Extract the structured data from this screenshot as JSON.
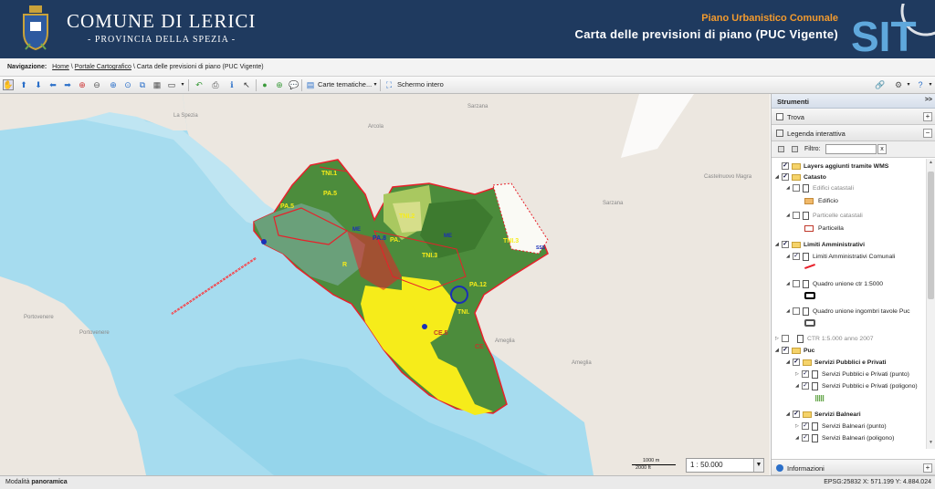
{
  "header": {
    "town": "COMUNE DI LERICI",
    "province": "- PROVINCIA DELLA SPEZIA -",
    "plan": "Piano Urbanistico Comunale",
    "map_title": "Carta delle previsioni di piano (PUC Vigente)",
    "logo_text": "SIT",
    "colors": {
      "background": "#1f3a5f",
      "accent": "#f29a2e"
    }
  },
  "breadcrumb": {
    "label": "Navigazione:",
    "home": "Home",
    "sep1": " \\ ",
    "portal": "Portale Cartografico",
    "sep2": " \\ ",
    "current": "Carta delle previsioni di piano (PUC Vigente)"
  },
  "toolbar": {
    "icons": [
      "pan-icon",
      "up-arrow-icon",
      "down-arrow-icon",
      "left-arrow-icon",
      "right-arrow-icon",
      "zoom-box-icon",
      "zoom-out-icon",
      "zoom-in-icon",
      "zoom-extent-icon",
      "zoom-layer-icon",
      "zoom-selection-icon",
      "measure-icon",
      "back-icon",
      "print-icon",
      "identify-icon",
      "select-icon",
      "globe-icon",
      "add-icon",
      "comment-icon",
      "layers-icon",
      "fullscreen-icon",
      "link-icon",
      "settings-icon",
      "help-icon"
    ],
    "thematic_maps": "Carte tematiche...",
    "fullscreen": "Schermo intero"
  },
  "map": {
    "places": [
      "La Spezia",
      "Sarzana",
      "Arcola",
      "Castelnuovo Magra",
      "Sarzana",
      "Portovenere",
      "Portovenere",
      "Ameglia",
      "Ameglia"
    ],
    "zones": [
      "TNI.1",
      "PA.5",
      "PA.5",
      "TNI.2",
      "ME",
      "PA.8",
      "TNI.3",
      "TNI.3",
      "PA.12",
      "SSS",
      "ME",
      "CE.5",
      "CE",
      "TNI.",
      "PA.",
      "R"
    ],
    "colors": {
      "sea": "#a6dcef",
      "land": "#ece7e0",
      "green": "#4c8c3c",
      "yellow": "#f6ec1a",
      "red": "#e8202a"
    }
  },
  "scale": {
    "bar_m": "1000 m",
    "bar_ft": "2000 ft",
    "value": "1 : 50.000"
  },
  "panel": {
    "title": "Strumenti",
    "collapse": ">>",
    "trova": "Trova",
    "legend": "Legenda interattiva",
    "filter_label": "Filtro:",
    "filter_clear": "x",
    "info": "Informazioni",
    "plus": "+",
    "minus": "−"
  },
  "tree": [
    {
      "label": "Layers aggiunti tramite WMS",
      "bold": true
    },
    {
      "label": "Catasto",
      "bold": true
    },
    {
      "label": "Edifici catastali",
      "gray": true
    },
    {
      "label": "Edificio"
    },
    {
      "label": "Particelle catastali",
      "gray": true
    },
    {
      "label": "Particella"
    },
    {
      "label": "Limiti Amministrativi",
      "bold": true
    },
    {
      "label": "Limiti Amministrativi Comunali"
    },
    {
      "label": "Quadro unione ctr 1:5000"
    },
    {
      "label": "Quadro unione ingombri tavole Puc"
    },
    {
      "label": "CTR 1:5.000 anno 2007",
      "gray": true
    },
    {
      "label": "Puc",
      "bold": true
    },
    {
      "label": "Servizi Pubblici e Privati",
      "bold": true
    },
    {
      "label": "Servizi Pubblici e Privati (punto)"
    },
    {
      "label": "Servizi Pubblici e Privati (poligono)"
    },
    {
      "label": "Servizi Balneari",
      "bold": true
    },
    {
      "label": "Servizi Balneari (punto)"
    },
    {
      "label": "Servizi Balneari (poligono)"
    }
  ],
  "status": {
    "mode_label": "Modalità ",
    "mode_value": "panoramica",
    "coords": "EPSG:25832  X: 571.199  Y: 4.884.024"
  }
}
